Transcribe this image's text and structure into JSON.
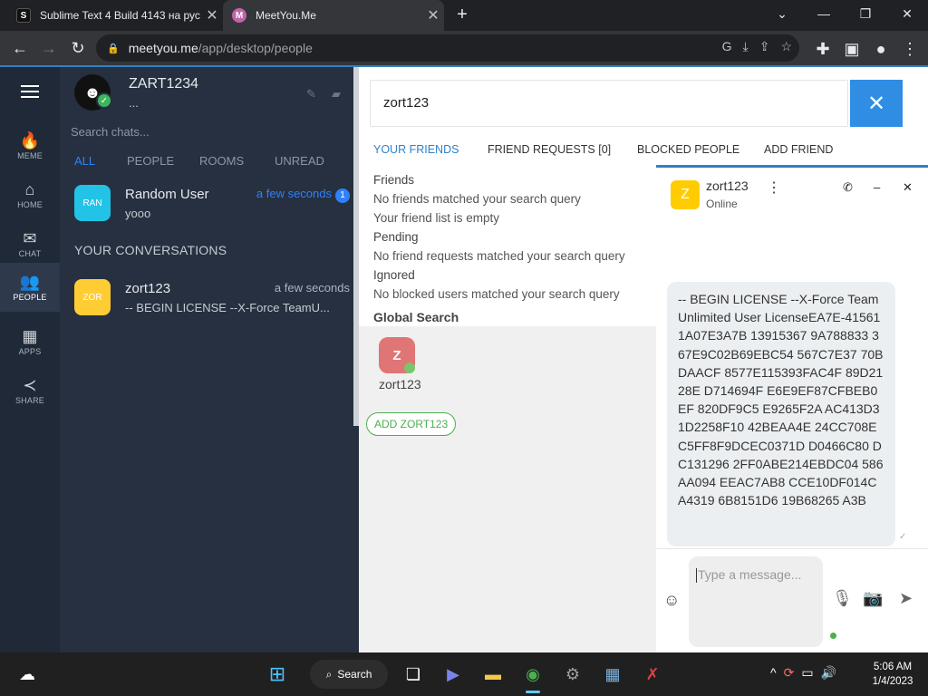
{
  "browser": {
    "tabs": [
      {
        "title": "Sublime Text 4 Build 4143 на рус",
        "favicon": "S"
      },
      {
        "title": "MeetYou.Me",
        "favicon": "M"
      }
    ],
    "url_host": "meetyou.me",
    "url_path": "/app/desktop/people",
    "new_tab": "+",
    "min": "—",
    "max": "❐",
    "close": "✕",
    "collapse": "⌄"
  },
  "rail": {
    "items": [
      {
        "label": "MEME",
        "icon": "🔥"
      },
      {
        "label": "HOME",
        "icon": "⌂"
      },
      {
        "label": "CHAT",
        "icon": "✉"
      },
      {
        "label": "PEOPLE",
        "icon": "👥"
      },
      {
        "label": "APPS",
        "icon": "▦"
      },
      {
        "label": "SHARE",
        "icon": "≺"
      }
    ]
  },
  "profile": {
    "name": "ZART1234",
    "status": "...",
    "avatar_glyph": "☻",
    "check": "✓"
  },
  "chats": {
    "search_placeholder": "Search chats...",
    "filters": [
      "ALL",
      "PEOPLE",
      "ROOMS",
      "UNREAD"
    ],
    "active_filter_color": "#2f81f7",
    "random": {
      "avatar": "RAN",
      "name": "Random User",
      "time": "a few seconds",
      "badge": "1",
      "message": "yooo",
      "color": "#22c3e6"
    },
    "section_title": "YOUR CONVERSATIONS",
    "conversations": [
      {
        "avatar": "ZOR",
        "name": "zort123",
        "time": "a few seconds",
        "message": "-- BEGIN LICENSE --X-Force TeamU...",
        "color": "#ffcc33"
      }
    ]
  },
  "people": {
    "search_value": "zort123",
    "close": "✕",
    "tabs": [
      "YOUR FRIENDS",
      "FRIEND REQUESTS [0]",
      "BLOCKED PEOPLE",
      "ADD FRIEND"
    ],
    "friends_heading": "Friends",
    "friends_none": "No friends matched your search query",
    "friends_empty": "Your friend list is empty",
    "pending_heading": "Pending",
    "pending_none": "No friend requests matched your search query",
    "ignored_heading": "Ignored",
    "ignored_none": "No blocked users matched your search query",
    "global_search": "Global Search",
    "result": {
      "avatar": "Z",
      "name": "zort123"
    },
    "add_button": "ADD ZORT123"
  },
  "chat_window": {
    "avatar": "Z",
    "name": "zort123",
    "status": "Online",
    "menu": "⋮",
    "phone": "✆",
    "minimize": "–",
    "close": "✕",
    "message": "-- BEGIN LICENSE --X-Force TeamUnlimited User LicenseEA7E-415611A07E3A7B 13915367 9A788833 367E9C02B69EBC54 567C7E37 70BDAACF 8577E115393FAC4F 89D2128E D714694F E6E9EF87CFBEB0EF 820DF9C5 E9265F2A AC413D31D2258F10 42BEAA4E 24CC708E C5FF8F9DCEC0371D D0466C80 DC131296 2FF0ABE214EBDC04 586AA094 EEAC7AB8 CCE10DF014CA4319 6B8151D6 19B68265 A3B",
    "tick": "✓",
    "input_placeholder": "Type a message...",
    "emoji": "☺",
    "mic": "🎙",
    "camera": "📷",
    "send": "➤"
  },
  "taskbar": {
    "search_label": "Search",
    "time": "5:06 AM",
    "date": "1/4/2023",
    "weather": "☁",
    "start": "⊞",
    "tray": [
      "^",
      "⟳",
      "▭",
      "🔊"
    ]
  }
}
